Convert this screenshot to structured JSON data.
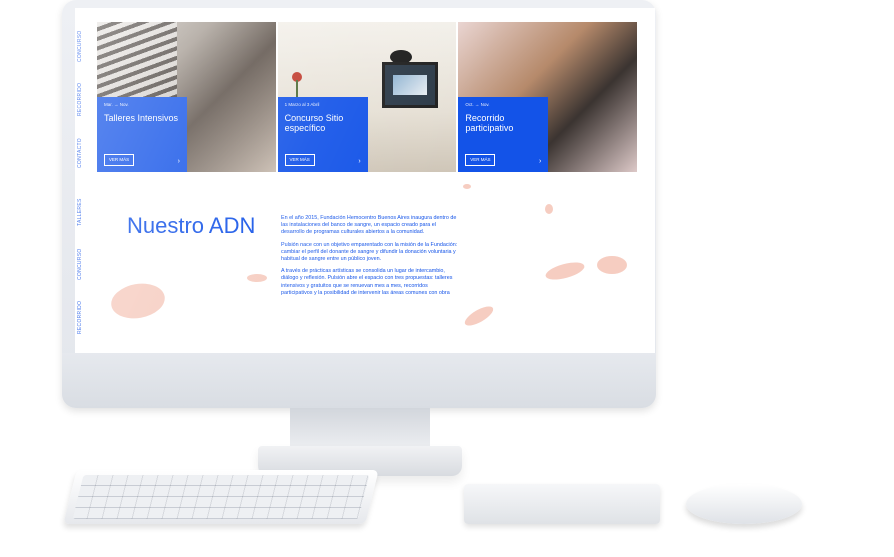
{
  "sidenav": {
    "items": [
      "CONCURSO",
      "RECORRIDO",
      "CONTACTO",
      "TALLERES",
      "CONCURSO",
      "RECORRIDO"
    ]
  },
  "cards": [
    {
      "date": "Mar. → Nov.",
      "title": "Talleres Intensivos",
      "button": "VER MÁS",
      "arrow": "›"
    },
    {
      "date": "1 Marzo al 3 Abril",
      "title": "Concurso Sitio específico",
      "button": "VER MÁS",
      "arrow": "›"
    },
    {
      "date": "Oct. → Nov.",
      "title": "Recorrido participativo",
      "button": "VER MÁS",
      "arrow": "›"
    }
  ],
  "adn": {
    "title": "Nuestro ADN",
    "paragraphs": [
      "En el año 2015, Fundación Hemocentro Buenos Aires inaugura dentro de las instalaciones del banco de sangre, un espacio creado para el desarrollo de programas culturales abiertos a la comunidad.",
      "Pulsión nace con un objetivo emparentado con la misión de la Fundación: cambiar el perfil del donante de sangre y difundir la donación voluntaria y habitual de sangre entre un público joven.",
      "A través de prácticas artísticas se consolida un lugar de intercambio, diálogo y reflexión. Pulsión abre el espacio con tres propuestas: talleres intensivos y gratuitos que se renuevan mes a mes, recorridos participativos y la posibilidad de intervenir las áreas comunes con obra"
    ]
  },
  "colors": {
    "accent": "#1353e8",
    "blob": "#f2b8a6"
  }
}
